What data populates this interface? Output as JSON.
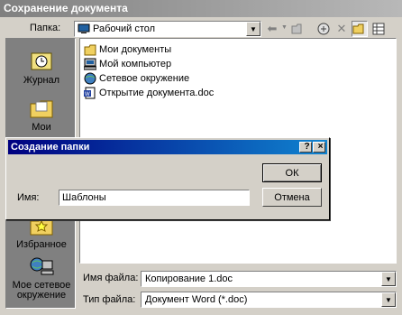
{
  "window": {
    "title": "Сохранение документа"
  },
  "toolbar": {
    "folder_label": "Папка:",
    "folder_value": "Рабочий стол"
  },
  "places": [
    {
      "label": "Журнал",
      "icon": "history-icon"
    },
    {
      "label": "Мои",
      "icon": "my-documents-icon"
    },
    {
      "label": "Избранное",
      "icon": "favorites-icon"
    },
    {
      "label": "Мое сетевое окружение",
      "icon": "network-places-icon"
    }
  ],
  "files": [
    {
      "name": "Мои документы",
      "icon": "my-documents-icon"
    },
    {
      "name": "Мой компьютер",
      "icon": "my-computer-icon"
    },
    {
      "name": "Сетевое окружение",
      "icon": "network-icon"
    },
    {
      "name": "Открытие документа.doc",
      "icon": "word-document-icon"
    }
  ],
  "dialog": {
    "title": "Создание папки",
    "help_label": "?",
    "close_label": "×",
    "name_label": "Имя:",
    "name_value": "Шаблоны",
    "ok_label": "ОК",
    "cancel_label": "Отмена"
  },
  "bottom": {
    "filename_label": "Имя файла:",
    "filename_value": "Копирование 1.doc",
    "filetype_label": "Тип файла:",
    "filetype_value": "Документ Word (*.doc)"
  }
}
